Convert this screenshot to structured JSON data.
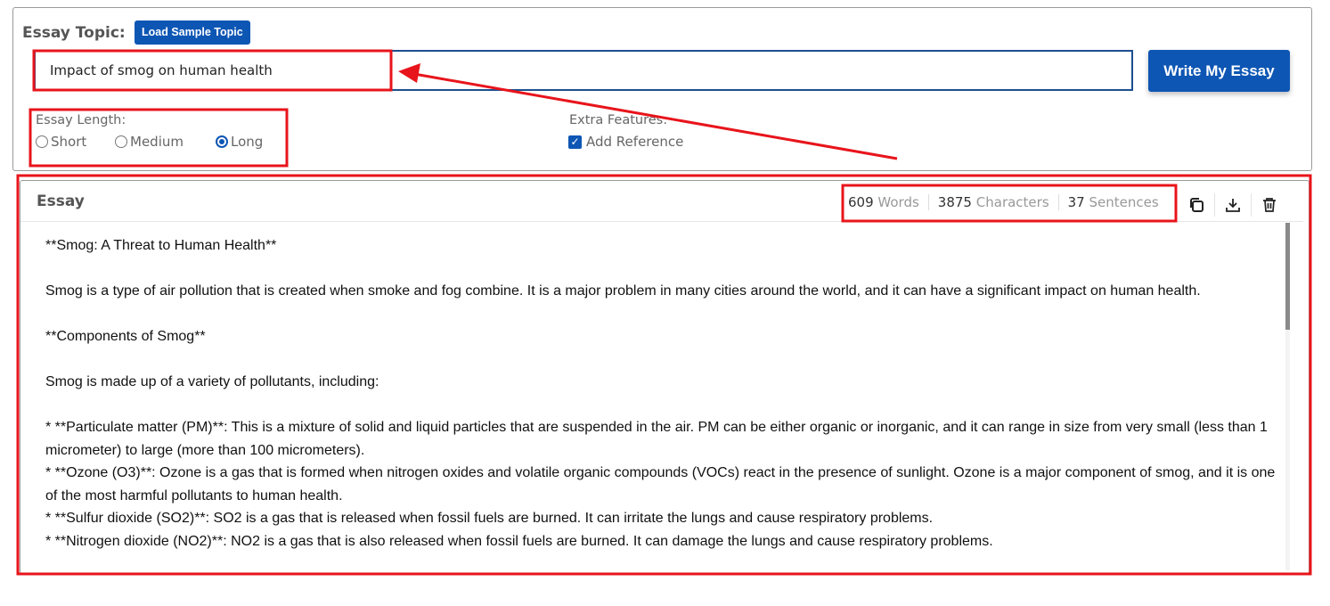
{
  "form": {
    "topic_label": "Essay Topic:",
    "sample_button": "Load Sample Topic",
    "topic_value": "Impact of smog on human health",
    "write_button": "Write My Essay",
    "length_label": "Essay Length:",
    "length_options": [
      "Short",
      "Medium",
      "Long"
    ],
    "length_selected": "Long",
    "extra_label": "Extra Features:",
    "extra_option": "Add Reference",
    "extra_checked": true
  },
  "essay": {
    "title": "Essay",
    "stats": [
      {
        "value": "609",
        "unit": "Words"
      },
      {
        "value": "3875",
        "unit": "Characters"
      },
      {
        "value": "37",
        "unit": "Sentences"
      }
    ],
    "icons": [
      "copy-icon",
      "download-icon",
      "trash-icon"
    ],
    "lines": [
      "**Smog: A Threat to Human Health**",
      "",
      "Smog is a type of air pollution that is created when smoke and fog combine. It is a major problem in many cities around the world, and it can have a significant impact on human health.",
      "",
      "**Components of Smog**",
      "",
      "Smog is made up of a variety of pollutants, including:",
      "",
      "* **Particulate matter (PM)**: This is a mixture of solid and liquid particles that are suspended in the air. PM can be either organic or inorganic, and it can range in size from very small (less than 1 micrometer) to large (more than 100 micrometers).",
      "* **Ozone (O3)**: Ozone is a gas that is formed when nitrogen oxides and volatile organic compounds (VOCs) react in the presence of sunlight. Ozone is a major component of smog, and it is one of the most harmful pollutants to human health.",
      "* **Sulfur dioxide (SO2)**: SO2 is a gas that is released when fossil fuels are burned. It can irritate the lungs and cause respiratory problems.",
      "* **Nitrogen dioxide (NO2)**: NO2 is a gas that is also released when fossil fuels are burned. It can damage the lungs and cause respiratory problems."
    ]
  },
  "colors": {
    "accent": "#0d56b4",
    "annotation": "#e8141b"
  }
}
